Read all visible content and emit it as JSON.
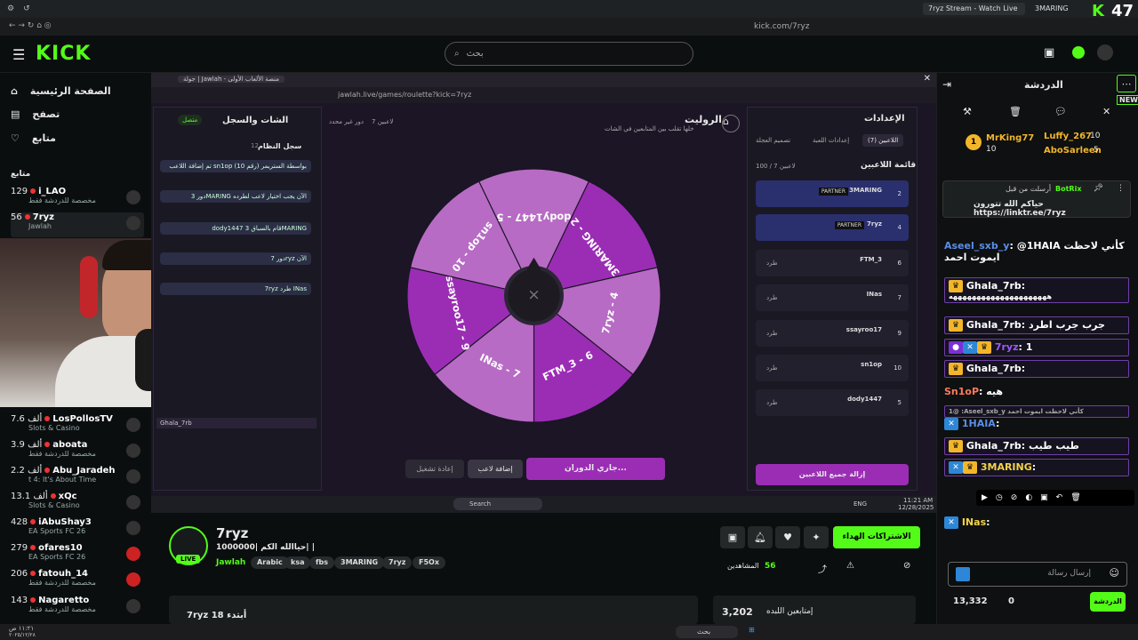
{
  "browser": {
    "tabs": [
      "7ryz Stream - Watch Live on Kick",
      "3MARING Stream - Watc..."
    ],
    "url": "kick.com/7ryz",
    "badge_number": "47"
  },
  "kick": {
    "logo": "KICK",
    "search_placeholder": "بحث"
  },
  "sidebar": {
    "nav": [
      "الصفحة الرئيسية",
      "تصفح",
      "متابع"
    ],
    "following_heading": "متابع",
    "channels": [
      {
        "name": "i_LAO",
        "viewers": "129",
        "sub": "مخصصة للدردشة فقط"
      },
      {
        "name": "7ryz",
        "viewers": "56",
        "sub": "Jawlah"
      },
      {
        "name": "LosPollosTV",
        "viewers": "7.6 ألف",
        "sub": "Slots & Casino"
      },
      {
        "name": "aboata",
        "viewers": "3.9 ألف",
        "sub": "مخصصة للدردشة فقط"
      },
      {
        "name": "Abu_Jaradeh",
        "viewers": "2.2 ألف",
        "sub": "t 4: It's About Time"
      },
      {
        "name": "xQc",
        "viewers": "13.1 ألف",
        "sub": "Slots & Casino"
      },
      {
        "name": "iAbuShay3",
        "viewers": "428",
        "sub": "EA Sports FC 26"
      },
      {
        "name": "ofares10",
        "viewers": "279",
        "sub": "EA Sports FC 26"
      },
      {
        "name": "fatouh_14",
        "viewers": "206",
        "sub": "مخصصة للدردشة فقط"
      },
      {
        "name": "Nagaretto",
        "viewers": "143",
        "sub": "مخصصة للدردشة فقط"
      }
    ]
  },
  "stream_page": {
    "inner_tab": "جولة | Jawlah - منصة الألعاب الأولى",
    "inner_url": "jawlah.live/games/roulette?kick=7ryz",
    "chat_title": "الشات والسجل",
    "connected": "متصل",
    "system_log": "سجل النظام",
    "system_count": "12",
    "system_messages": [
      "تم إضافة اللاعب sn1op بواسطة الستريمر (رقم 10)",
      "دور 3MARING الآن يجب اختيار لاعب لطرده",
      "dody1447 قام بالسباق 3MARING",
      "دور 7ryz الآن",
      "7ryz طرد INas"
    ],
    "system_label": "System",
    "system_time": "11:20 AM",
    "roulette_title": "الروليت",
    "roulette_sub": "خلها تقلب بين المتابعين في الشات",
    "players_count": "7 لاعبين",
    "round_status": "دور غير محدد",
    "wheel_segments": [
      "dody1447 - 5",
      "3MARING - 2",
      "7ryz - 4",
      "FTM_3 - 6",
      "INas - 7",
      "ssayroo17 - 9",
      "sn1op - 10"
    ],
    "settings_title": "الإعدادات",
    "settings_tabs": [
      "اللاعبين (7)",
      "إعدادات اللعبة",
      "تصميم العجلة"
    ],
    "players_list_title": "قائمة اللاعبين",
    "players_capacity": "100 / 7 لاعبين",
    "players": [
      {
        "name": "3MARING",
        "num": "2",
        "partner": "PARTNER"
      },
      {
        "name": "7ryz",
        "num": "4",
        "partner": "PARTNER"
      },
      {
        "name": "FTM_3",
        "num": "6",
        "partner": ""
      },
      {
        "name": "INas",
        "num": "7",
        "partner": ""
      },
      {
        "name": "ssayroo17",
        "num": "9",
        "partner": ""
      },
      {
        "name": "sn1op",
        "num": "10",
        "partner": ""
      },
      {
        "name": "dody1447",
        "num": "5",
        "partner": ""
      }
    ],
    "kick_label": "طرد",
    "remove_all": "إزالة جميع اللاعبين",
    "spinning": "جاري الدوران...",
    "add_player": "إضافة لاعب",
    "restart": "إعادة تشغيل",
    "win_search": "Search",
    "win_time": "11:21 AM",
    "win_date": "12/28/2025",
    "win_lang": "ENG"
  },
  "stream_info": {
    "channel": "7ryz",
    "title": "حياالله الكم |1000000| |",
    "category": "Jawlah",
    "tags": [
      "Arabic",
      "ksa",
      "fbs",
      "3MARING",
      "7ryz",
      "F5Ox"
    ],
    "live": "LIVE",
    "viewers": "56",
    "viewers_label": "المشاهدين",
    "subscribe": "الاشتراكات الهداء",
    "supporters_label": "إمتابعين اللبده",
    "supporters": "3,202",
    "bottom_text": "7ryz أبتدء 18"
  },
  "chat": {
    "title": "الدردشة",
    "new_badge": "NEW",
    "top_gifters": [
      {
        "name": "MrKing77",
        "count": "10",
        "rank": "1"
      },
      {
        "name": "Luffy_267",
        "count": "10"
      },
      {
        "name": "AboSarleen",
        "count": "5"
      }
    ],
    "pinned_by": "أرسلت من قبل",
    "pinned_user": "BotRix",
    "pinned_text": "حياكم الله تتورون https://linktr.ee/7ryz",
    "messages": [
      {
        "user": "Aseel_sxb_y",
        "text": "@1HAIA كأني لاحظت ايموت احمد"
      },
      {
        "user": "Ghala_7rb",
        "text": "هههههههههههههههههههههه"
      },
      {
        "user": "Ghala_7rb",
        "text": "جرب جرب اطرد"
      },
      {
        "user": "7ryz",
        "text": "1"
      },
      {
        "user": "Ghala_7rb",
        "text": ""
      },
      {
        "user": "Sn1oP",
        "text": "هيه"
      },
      {
        "user": "1HAIA",
        "text": ""
      },
      {
        "user": "Ghala_7rb",
        "text": "طيب طيب"
      },
      {
        "user": "3MARING",
        "text": ""
      },
      {
        "user": "INas",
        "text": ""
      }
    ],
    "reply_hint": "1@ :Aseel_sxb_y كأني لاحظت ايموت احمد",
    "input_placeholder": "إرسال رسالة",
    "points": "13,332",
    "zero": "0",
    "chat_button": "الدردشة"
  },
  "taskbar": {
    "search": "بحث",
    "time": "١١:٢١ ص",
    "date": "٢٠٢٥/١٢/٢٨"
  },
  "colors": {
    "kick_green": "#53fc18",
    "purple": "#9b2db5",
    "wheel_light": "#b76bc4"
  }
}
